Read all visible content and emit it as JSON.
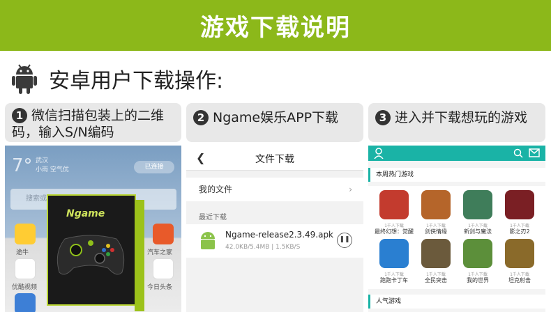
{
  "banner": {
    "title": "游戏下载说明"
  },
  "subtitle": "安卓用户下载操作:",
  "steps": [
    {
      "num": "1",
      "line1": "微信扫描包装上的二维",
      "line2": "码，输入S/N编码"
    },
    {
      "num": "2",
      "line1": "Ngame娱乐APP下载",
      "line2": ""
    },
    {
      "num": "3",
      "line1": "进入并下载想玩的游戏",
      "line2": ""
    }
  ],
  "phone1": {
    "temperature": "7°",
    "city": "武汉",
    "weather": "小雨 空气优",
    "wifi_status": "已连接",
    "search_placeholder": "搜索或输入网址",
    "apps": [
      "途牛",
      "汽车之家",
      "优酷视频",
      "今日头条"
    ],
    "box_brand": "Ngame"
  },
  "phone2": {
    "title": "文件下载",
    "my_files": "我的文件",
    "recent": "最近下载",
    "apk_name": "Ngame-release2.3.49.apk",
    "apk_meta": "42.0KB/5.4MB | 1.5KB/S"
  },
  "phone3": {
    "section_hot": "本周热门游戏",
    "section_popular": "人气游戏",
    "games": [
      {
        "name": "最终幻想：觉醒",
        "sub": "1千人下载",
        "color": "#c33b2e"
      },
      {
        "name": "剑侠情缘",
        "sub": "1千人下载",
        "color": "#b5652a"
      },
      {
        "name": "新剑与魔法",
        "sub": "1千人下载",
        "color": "#3f7d5a"
      },
      {
        "name": "影之刃2",
        "sub": "1千人下载",
        "color": "#7a1f24"
      },
      {
        "name": "跑跑卡丁车",
        "sub": "1千人下载",
        "color": "#2a7fd1"
      },
      {
        "name": "全民突击",
        "sub": "1千人下载",
        "color": "#6b5a3c"
      },
      {
        "name": "我的世界",
        "sub": "1千人下载",
        "color": "#5c8f3a"
      },
      {
        "name": "坦克射击",
        "sub": "1千人下载",
        "color": "#8a6a2a"
      }
    ]
  }
}
